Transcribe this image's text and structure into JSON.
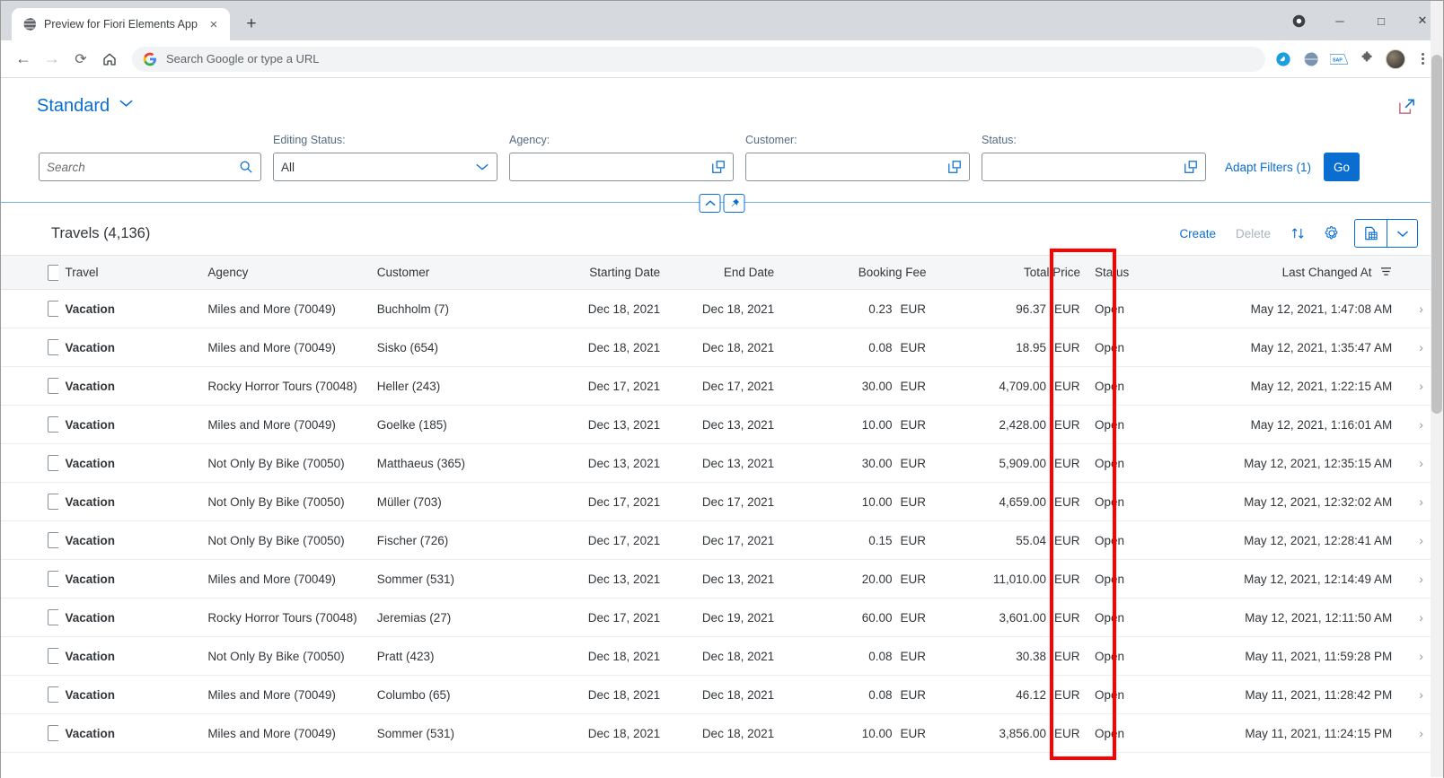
{
  "browser": {
    "tab_title": "Preview for Fiori Elements App",
    "tab_favicon": "globe-icon",
    "close_tab": "×",
    "new_tab": "+",
    "omnibox_placeholder": "Search Google or type a URL",
    "back": "←",
    "forward": "→",
    "reload": "⟳",
    "home": "⌂",
    "minimize": "─",
    "maximize": "□",
    "close": "✕",
    "record_icon": "record-circle-icon",
    "extensions": [
      "translate-extension-icon",
      "globe-extension-icon",
      "sap-extension-icon",
      "puzzle-extensions-icon"
    ],
    "profile": "avatar"
  },
  "app": {
    "variant_title": "Standard",
    "variant_chevron": "chevron-down-icon",
    "share_icon": "share-export-icon"
  },
  "filters": {
    "search": {
      "placeholder": "Search",
      "value": "",
      "icon": "search-icon"
    },
    "editing_status": {
      "label": "Editing Status:",
      "value": "All",
      "icon": "chevron-down-icon"
    },
    "agency": {
      "label": "Agency:",
      "value": "",
      "icon": "value-help-icon"
    },
    "customer": {
      "label": "Customer:",
      "value": "",
      "icon": "value-help-icon"
    },
    "status": {
      "label": "Status:",
      "value": "",
      "icon": "value-help-icon"
    },
    "adapt_filters": "Adapt Filters (1)",
    "go": "Go",
    "collapse_icon": "chevron-up-icon",
    "pin_icon": "pin-icon"
  },
  "table": {
    "title": "Travels (4,136)",
    "actions": {
      "create": "Create",
      "delete": "Delete",
      "sort_icon": "sort-arrows-icon",
      "settings_icon": "gear-icon",
      "export_icon": "export-spreadsheet-icon",
      "export_arrow_icon": "chevron-down-icon"
    },
    "columns": [
      {
        "key": "select",
        "label": ""
      },
      {
        "key": "travel",
        "label": "Travel"
      },
      {
        "key": "agency",
        "label": "Agency"
      },
      {
        "key": "customer",
        "label": "Customer"
      },
      {
        "key": "starting_date",
        "label": "Starting Date"
      },
      {
        "key": "end_date",
        "label": "End Date"
      },
      {
        "key": "booking_fee",
        "label": "Booking Fee"
      },
      {
        "key": "total_price",
        "label": "Total Price"
      },
      {
        "key": "status",
        "label": "Status"
      },
      {
        "key": "last_changed_at",
        "label": "Last Changed At"
      }
    ],
    "sorted_column": "Last Changed At",
    "rows": [
      {
        "travel": "Vacation",
        "agency": "Miles and More (70049)",
        "customer": "Buchholm (7)",
        "starting_date": "Dec 18, 2021",
        "end_date": "Dec 18, 2021",
        "booking_fee": "0.23",
        "booking_fee_cur": "EUR",
        "total_price": "96.37",
        "total_price_cur": "EUR",
        "status": "Open",
        "last_changed_at": "May 12, 2021, 1:47:08 AM"
      },
      {
        "travel": "Vacation",
        "agency": "Miles and More (70049)",
        "customer": "Sisko (654)",
        "starting_date": "Dec 18, 2021",
        "end_date": "Dec 18, 2021",
        "booking_fee": "0.08",
        "booking_fee_cur": "EUR",
        "total_price": "18.95",
        "total_price_cur": "EUR",
        "status": "Open",
        "last_changed_at": "May 12, 2021, 1:35:47 AM"
      },
      {
        "travel": "Vacation",
        "agency": "Rocky Horror Tours (70048)",
        "customer": "Heller (243)",
        "starting_date": "Dec 17, 2021",
        "end_date": "Dec 17, 2021",
        "booking_fee": "30.00",
        "booking_fee_cur": "EUR",
        "total_price": "4,709.00",
        "total_price_cur": "EUR",
        "status": "Open",
        "last_changed_at": "May 12, 2021, 1:22:15 AM"
      },
      {
        "travel": "Vacation",
        "agency": "Miles and More (70049)",
        "customer": "Goelke (185)",
        "starting_date": "Dec 13, 2021",
        "end_date": "Dec 13, 2021",
        "booking_fee": "10.00",
        "booking_fee_cur": "EUR",
        "total_price": "2,428.00",
        "total_price_cur": "EUR",
        "status": "Open",
        "last_changed_at": "May 12, 2021, 1:16:01 AM"
      },
      {
        "travel": "Vacation",
        "agency": "Not Only By Bike (70050)",
        "customer": "Matthaeus (365)",
        "starting_date": "Dec 13, 2021",
        "end_date": "Dec 13, 2021",
        "booking_fee": "30.00",
        "booking_fee_cur": "EUR",
        "total_price": "5,909.00",
        "total_price_cur": "EUR",
        "status": "Open",
        "last_changed_at": "May 12, 2021, 12:35:15 AM"
      },
      {
        "travel": "Vacation",
        "agency": "Not Only By Bike (70050)",
        "customer": "Müller (703)",
        "starting_date": "Dec 17, 2021",
        "end_date": "Dec 17, 2021",
        "booking_fee": "10.00",
        "booking_fee_cur": "EUR",
        "total_price": "4,659.00",
        "total_price_cur": "EUR",
        "status": "Open",
        "last_changed_at": "May 12, 2021, 12:32:02 AM"
      },
      {
        "travel": "Vacation",
        "agency": "Not Only By Bike (70050)",
        "customer": "Fischer (726)",
        "starting_date": "Dec 17, 2021",
        "end_date": "Dec 17, 2021",
        "booking_fee": "0.15",
        "booking_fee_cur": "EUR",
        "total_price": "55.04",
        "total_price_cur": "EUR",
        "status": "Open",
        "last_changed_at": "May 12, 2021, 12:28:41 AM"
      },
      {
        "travel": "Vacation",
        "agency": "Miles and More (70049)",
        "customer": "Sommer (531)",
        "starting_date": "Dec 13, 2021",
        "end_date": "Dec 13, 2021",
        "booking_fee": "20.00",
        "booking_fee_cur": "EUR",
        "total_price": "11,010.00",
        "total_price_cur": "EUR",
        "status": "Open",
        "last_changed_at": "May 12, 2021, 12:14:49 AM"
      },
      {
        "travel": "Vacation",
        "agency": "Rocky Horror Tours (70048)",
        "customer": "Jeremias (27)",
        "starting_date": "Dec 17, 2021",
        "end_date": "Dec 19, 2021",
        "booking_fee": "60.00",
        "booking_fee_cur": "EUR",
        "total_price": "3,601.00",
        "total_price_cur": "EUR",
        "status": "Open",
        "last_changed_at": "May 12, 2021, 12:11:50 AM"
      },
      {
        "travel": "Vacation",
        "agency": "Not Only By Bike (70050)",
        "customer": "Pratt (423)",
        "starting_date": "Dec 18, 2021",
        "end_date": "Dec 18, 2021",
        "booking_fee": "0.08",
        "booking_fee_cur": "EUR",
        "total_price": "30.38",
        "total_price_cur": "EUR",
        "status": "Open",
        "last_changed_at": "May 11, 2021, 11:59:28 PM"
      },
      {
        "travel": "Vacation",
        "agency": "Miles and More (70049)",
        "customer": "Columbo (65)",
        "starting_date": "Dec 18, 2021",
        "end_date": "Dec 18, 2021",
        "booking_fee": "0.08",
        "booking_fee_cur": "EUR",
        "total_price": "46.12",
        "total_price_cur": "EUR",
        "status": "Open",
        "last_changed_at": "May 11, 2021, 11:28:42 PM"
      },
      {
        "travel": "Vacation",
        "agency": "Miles and More (70049)",
        "customer": "Sommer (531)",
        "starting_date": "Dec 18, 2021",
        "end_date": "Dec 18, 2021",
        "booking_fee": "10.00",
        "booking_fee_cur": "EUR",
        "total_price": "3,856.00",
        "total_price_cur": "EUR",
        "status": "Open",
        "last_changed_at": "May 11, 2021, 11:24:15 PM"
      }
    ]
  },
  "annotation": {
    "color": "#ff0000",
    "target_column": "Status"
  }
}
